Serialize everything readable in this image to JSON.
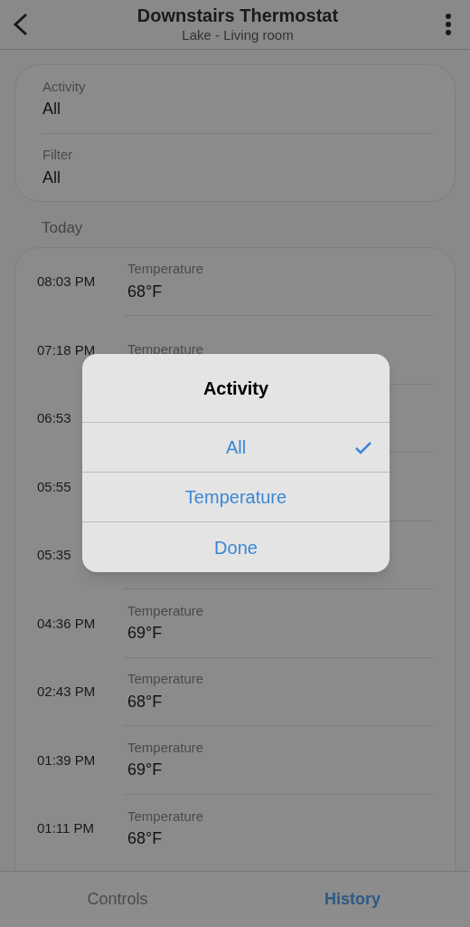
{
  "header": {
    "title": "Downstairs Thermostat",
    "subtitle": "Lake - Living room"
  },
  "filters": [
    {
      "label": "Activity",
      "value": "All"
    },
    {
      "label": "Filter",
      "value": "All"
    }
  ],
  "section": "Today",
  "rows": [
    {
      "time": "08:03 PM",
      "label": "Temperature",
      "value": "68°F"
    },
    {
      "time": "07:18 PM",
      "label": "Temperature"
    },
    {
      "time": "06:53"
    },
    {
      "time": "05:55"
    },
    {
      "time": "05:35"
    },
    {
      "time": "04:36 PM",
      "label": "Temperature",
      "value": "69°F"
    },
    {
      "time": "02:43 PM",
      "label": "Temperature",
      "value": "68°F"
    },
    {
      "time": "01:39 PM",
      "label": "Temperature",
      "value": "69°F"
    },
    {
      "time": "01:11 PM",
      "label": "Temperature",
      "value": "68°F"
    }
  ],
  "tabs": [
    {
      "label": "Controls",
      "selected": false
    },
    {
      "label": "History",
      "selected": true
    }
  ],
  "dialog": {
    "title": "Activity",
    "options": [
      {
        "label": "All",
        "selected": true
      },
      {
        "label": "Temperature",
        "selected": false
      }
    ],
    "done": "Done"
  }
}
